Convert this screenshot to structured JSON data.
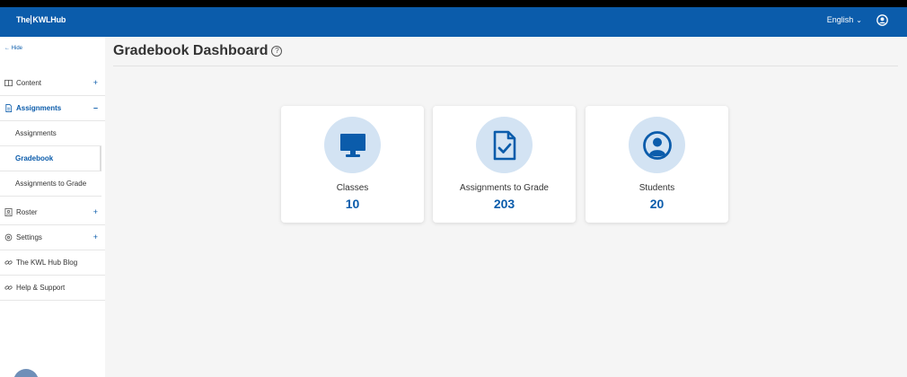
{
  "header": {
    "logo_text": "TheKWLHub",
    "logo_part1": "The",
    "logo_part2": "KWLHub",
    "language": "English",
    "brand_color": "#0b5cab"
  },
  "sidebar": {
    "hide_label": "← Hide",
    "items": [
      {
        "label": "Content",
        "icon": "book-icon",
        "toggle": "+"
      },
      {
        "label": "Assignments",
        "icon": "document-icon",
        "toggle": "–"
      },
      {
        "label": "Roster",
        "icon": "roster-icon",
        "toggle": "+"
      },
      {
        "label": "Settings",
        "icon": "gear-icon",
        "toggle": "+"
      },
      {
        "label": "The KWL Hub Blog",
        "icon": "link-icon"
      },
      {
        "label": "Help & Support",
        "icon": "link-icon"
      }
    ],
    "assignments_sub": [
      {
        "label": "Assignments"
      },
      {
        "label": "Gradebook"
      },
      {
        "label": "Assignments to Grade"
      }
    ]
  },
  "main": {
    "title": "Gradebook Dashboard",
    "help_glyph": "?",
    "cards": [
      {
        "label": "Classes",
        "value": "10",
        "icon": "monitor-icon"
      },
      {
        "label": "Assignments to Grade",
        "value": "203",
        "icon": "graded-document-icon"
      },
      {
        "label": "Students",
        "value": "20",
        "icon": "student-icon"
      }
    ]
  }
}
